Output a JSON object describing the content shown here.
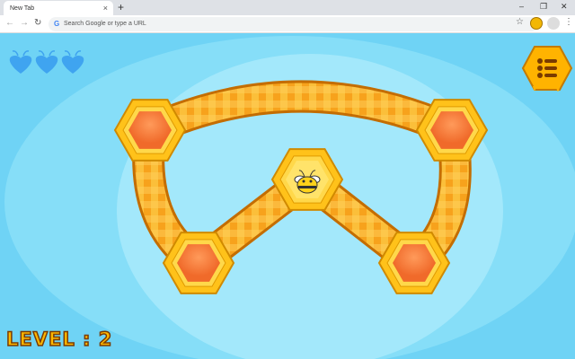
{
  "browser": {
    "tab_title": "New Tab",
    "new_tab": "+",
    "close_tab": "×",
    "minimize": "–",
    "restore": "❐",
    "close": "✕",
    "omnibox_placeholder": "Search Google or type a URL",
    "google_g": "G"
  },
  "game": {
    "level_label": "LEVEL : 2",
    "lives": 3,
    "colors": {
      "sky": "#6fd3f5",
      "honey": "#ffc21a",
      "path": "#f9a825"
    }
  }
}
